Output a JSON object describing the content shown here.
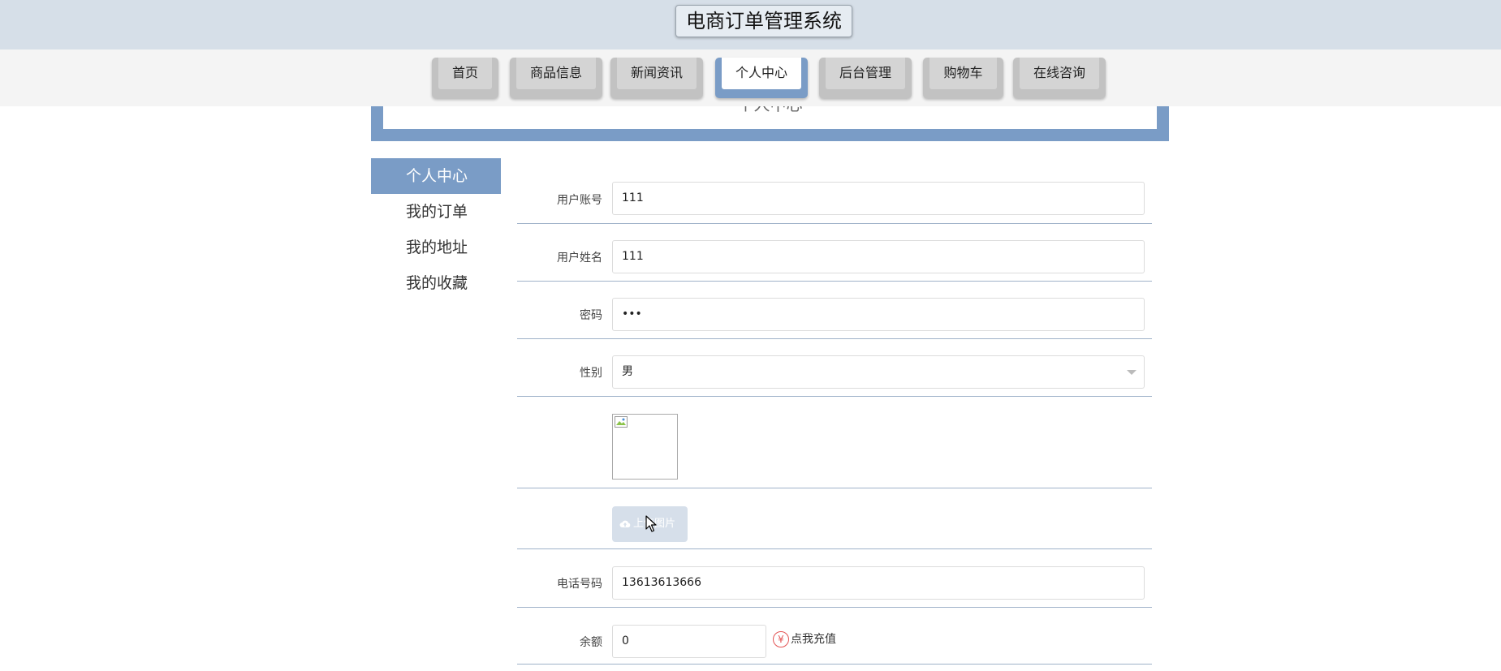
{
  "header": {
    "title": "电商订单管理系统"
  },
  "nav": {
    "items": [
      {
        "label": "首页"
      },
      {
        "label": "商品信息"
      },
      {
        "label": "新闻资讯"
      },
      {
        "label": "个人中心",
        "active": true
      },
      {
        "label": "后台管理"
      },
      {
        "label": "购物车"
      },
      {
        "label": "在线咨询"
      }
    ]
  },
  "banner": {
    "title": "个人中心"
  },
  "sidebar": {
    "items": [
      {
        "label": "个人中心",
        "active": true
      },
      {
        "label": "我的订单"
      },
      {
        "label": "我的地址"
      },
      {
        "label": "我的收藏"
      }
    ]
  },
  "form": {
    "account": {
      "label": "用户账号",
      "value": "111"
    },
    "name": {
      "label": "用户姓名",
      "value": "111"
    },
    "password": {
      "label": "密码",
      "value": "•••"
    },
    "gender": {
      "label": "性别",
      "value": "男"
    },
    "upload": {
      "label": "上传图片"
    },
    "phone": {
      "label": "电话号码",
      "value": "13613613666"
    },
    "balance": {
      "label": "余额",
      "value": "0",
      "recharge_label": "点我充值",
      "recharge_symbol": "¥"
    }
  },
  "colors": {
    "accent": "#7a9cc6",
    "header_bg": "#d6dfe8",
    "danger": "#e35454"
  }
}
